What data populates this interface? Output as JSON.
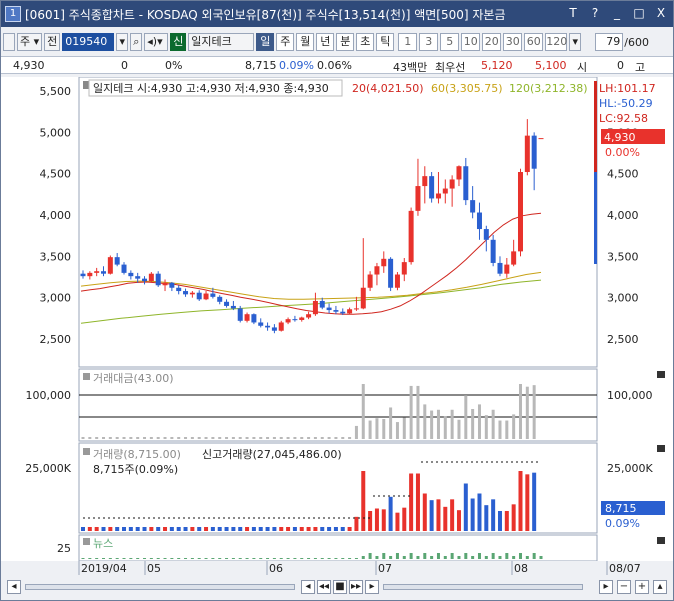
{
  "window": {
    "badge": "1",
    "title": "[0601] 주식종합차트 - KOSDAQ 외국인보유[87(천)] 주식수[13,514(천)] 액면[500] 자본금",
    "buttons": [
      "T",
      "?",
      "_",
      "□",
      "X"
    ]
  },
  "toolbar": {
    "mode": "주",
    "range": "전",
    "code": "019540",
    "sin_badge": "신",
    "stock_name": "일지테크",
    "periods": [
      "일",
      "주",
      "월",
      "년",
      "분",
      "초",
      "틱"
    ],
    "minutes": [
      "1",
      "3",
      "5",
      "10",
      "20",
      "30",
      "60",
      "120"
    ],
    "count": "79",
    "count_total": "/600"
  },
  "info": {
    "price": "4,930",
    "change": "0",
    "change_pct": "0%",
    "volume": "8,715",
    "vol_pct": "0.09%",
    "turnover": "0.06%",
    "amount": "43백만",
    "order_label": "최우선",
    "ask": "5,120",
    "bid": "5,100",
    "open_label": "시",
    "open_val": "0",
    "high_label": "고"
  },
  "price_panel": {
    "ohlc_label": "일지테크 시:4,930 고:4,930 저:4,930 종:4,930",
    "ma20": "20(4,021.50)",
    "ma60": "60(3,305.75)",
    "ma120": "120(3,212.38)",
    "lh": "LH:101.17",
    "hl": "HL:-50.29",
    "lc": "LC:92.58",
    "current": "4,930",
    "current_pct": "0.00%",
    "yticks": [
      "5,500",
      "5,000",
      "4,500",
      "4,000",
      "3,500",
      "3,000",
      "2,500"
    ],
    "yticks_right": [
      "5,000",
      "4,500",
      "4,000",
      "3,500",
      "3,000",
      "2,500"
    ]
  },
  "amount_panel": {
    "label": "거래대금(43.00)",
    "ytick": "100,000"
  },
  "volume_panel": {
    "label": "거래량(8,715.00)",
    "label2": "신고거래량(27,045,486.00)",
    "sub": "8,715주(0.09%)",
    "ytick_left": "25,000K",
    "ytick_right": "25,000K",
    "current": "8,715",
    "current_pct": "0.09%"
  },
  "news_panel": {
    "label": "뉴스",
    "ytick": "25"
  },
  "xaxis": {
    "labels": [
      "2019/04",
      "05",
      "06",
      "07",
      "08",
      "08/07"
    ]
  },
  "colors": {
    "up": "#e8322c",
    "down": "#2a5fd0",
    "ma20": "#d0261f",
    "ma60": "#c8a216",
    "ma120": "#8fb52a"
  },
  "chart_data": {
    "type": "candlestick",
    "series_note": "daily candles, approximate values read from the chart",
    "candles": [
      [
        3290,
        3330,
        3230,
        3260
      ],
      [
        3260,
        3320,
        3220,
        3300
      ],
      [
        3300,
        3360,
        3260,
        3320
      ],
      [
        3320,
        3380,
        3260,
        3290
      ],
      [
        3290,
        3510,
        3280,
        3490
      ],
      [
        3490,
        3540,
        3380,
        3400
      ],
      [
        3400,
        3430,
        3280,
        3300
      ],
      [
        3300,
        3330,
        3220,
        3260
      ],
      [
        3260,
        3300,
        3180,
        3230
      ],
      [
        3230,
        3260,
        3160,
        3200
      ],
      [
        3200,
        3310,
        3180,
        3290
      ],
      [
        3290,
        3320,
        3130,
        3150
      ],
      [
        3150,
        3220,
        3080,
        3180
      ],
      [
        3180,
        3190,
        3080,
        3120
      ],
      [
        3120,
        3150,
        3040,
        3080
      ],
      [
        3080,
        3110,
        3010,
        3040
      ],
      [
        3040,
        3080,
        3000,
        3060
      ],
      [
        3060,
        3090,
        2960,
        2980
      ],
      [
        2980,
        3080,
        2970,
        3050
      ],
      [
        3050,
        3120,
        2990,
        3010
      ],
      [
        3010,
        3030,
        2920,
        2950
      ],
      [
        2950,
        2980,
        2880,
        2900
      ],
      [
        2900,
        2960,
        2850,
        2870
      ],
      [
        2870,
        2900,
        2700,
        2720
      ],
      [
        2720,
        2820,
        2700,
        2800
      ],
      [
        2800,
        2810,
        2680,
        2700
      ],
      [
        2700,
        2750,
        2640,
        2660
      ],
      [
        2660,
        2700,
        2600,
        2640
      ],
      [
        2640,
        2680,
        2570,
        2600
      ],
      [
        2600,
        2720,
        2590,
        2700
      ],
      [
        2700,
        2760,
        2680,
        2740
      ],
      [
        2740,
        2780,
        2710,
        2730
      ],
      [
        2730,
        2770,
        2710,
        2760
      ],
      [
        2760,
        2830,
        2740,
        2800
      ],
      [
        2800,
        3060,
        2780,
        2960
      ],
      [
        2960,
        3000,
        2860,
        2880
      ],
      [
        2880,
        2930,
        2810,
        2850
      ],
      [
        2850,
        2900,
        2800,
        2830
      ],
      [
        2830,
        2870,
        2790,
        2810
      ],
      [
        2810,
        2880,
        2800,
        2860
      ],
      [
        2860,
        3010,
        2840,
        2870
      ],
      [
        2870,
        3720,
        2860,
        3120
      ],
      [
        3120,
        3320,
        3080,
        3280
      ],
      [
        3280,
        3420,
        3150,
        3380
      ],
      [
        3380,
        3560,
        3300,
        3470
      ],
      [
        3470,
        3490,
        3080,
        3120
      ],
      [
        3120,
        3310,
        3090,
        3280
      ],
      [
        3280,
        3480,
        3200,
        3430
      ],
      [
        3430,
        4090,
        3400,
        4050
      ],
      [
        4050,
        4680,
        3990,
        4350
      ],
      [
        4350,
        4590,
        4140,
        4470
      ],
      [
        4470,
        4520,
        4150,
        4200
      ],
      [
        4200,
        4520,
        4140,
        4260
      ],
      [
        4260,
        4430,
        4140,
        4320
      ],
      [
        4320,
        4480,
        4100,
        4430
      ],
      [
        4430,
        4600,
        4350,
        4590
      ],
      [
        4590,
        4690,
        4120,
        4180
      ],
      [
        4180,
        4350,
        3960,
        4030
      ],
      [
        4030,
        4150,
        3700,
        3830
      ],
      [
        3830,
        3870,
        3560,
        3700
      ],
      [
        3700,
        3760,
        3380,
        3420
      ],
      [
        3420,
        3500,
        3260,
        3290
      ],
      [
        3290,
        3480,
        3240,
        3400
      ],
      [
        3400,
        3700,
        3380,
        3560
      ],
      [
        3560,
        4560,
        3500,
        4520
      ],
      [
        4520,
        5160,
        4480,
        4960
      ],
      [
        4960,
        5000,
        4300,
        4560
      ],
      [
        4930,
        4930,
        4930,
        4930
      ]
    ],
    "ma20": [
      3080,
      3095,
      3110,
      3130,
      3150,
      3175,
      3185,
      3190,
      3180,
      3170,
      3160,
      3140,
      3120,
      3100,
      3075,
      3050,
      3030,
      3005,
      2985,
      2965,
      2940,
      2915,
      2890,
      2865,
      2845,
      2830,
      2815,
      2805,
      2800,
      2800,
      2805,
      2815,
      2830,
      2860,
      2900,
      2960,
      3030,
      3110,
      3190,
      3270,
      3360,
      3460,
      3570,
      3680,
      3790,
      3880,
      3950,
      3990,
      4010,
      4021
    ],
    "ma60": [
      3140,
      3160,
      3180,
      3195,
      3200,
      3195,
      3180,
      3160,
      3130,
      3100,
      3070,
      3040,
      3010,
      2990,
      2980,
      2980,
      2985,
      2990,
      2995,
      3000,
      3005,
      3015,
      3030,
      3050,
      3070,
      3095,
      3125,
      3160,
      3200,
      3240,
      3280,
      3306
    ],
    "ma120": [
      2690,
      2720,
      2750,
      2775,
      2800,
      2820,
      2840,
      2855,
      2870,
      2885,
      2900,
      2915,
      2930,
      2950,
      2970,
      2990,
      3010,
      3035,
      3060,
      3090,
      3120,
      3160,
      3190,
      3212
    ]
  }
}
